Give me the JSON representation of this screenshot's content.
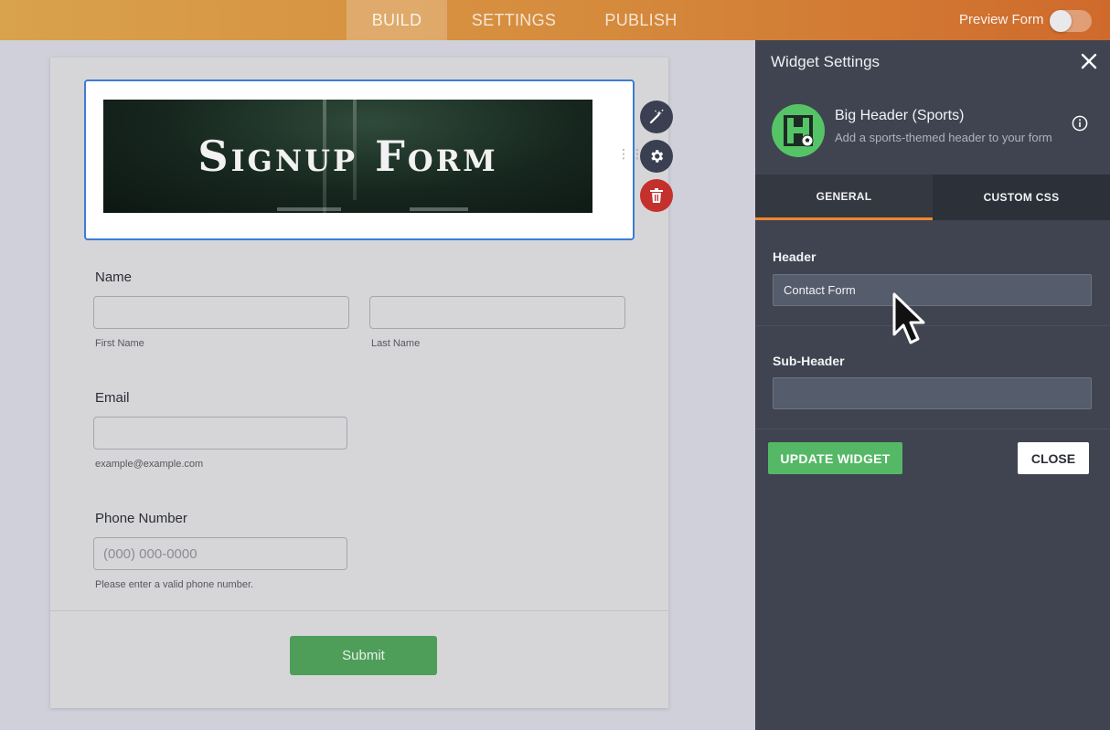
{
  "topbar": {
    "tabs": [
      "BUILD",
      "SETTINGS",
      "PUBLISH"
    ],
    "active_tab": "BUILD",
    "preview_label": "Preview Form",
    "preview_enabled": false
  },
  "form": {
    "header_banner_text": "Signup Form",
    "fields": {
      "name": {
        "label": "Name",
        "first_sublabel": "First Name",
        "last_sublabel": "Last Name"
      },
      "email": {
        "label": "Email",
        "sublabel": "example@example.com"
      },
      "phone": {
        "label": "Phone Number",
        "placeholder": "(000) 000-0000",
        "sublabel": "Please enter a valid phone number."
      }
    },
    "submit_label": "Submit"
  },
  "panel": {
    "title": "Widget Settings",
    "widget_name": "Big Header (Sports)",
    "widget_desc": "Add a sports-themed header to your form",
    "tabs": [
      "GENERAL",
      "CUSTOM CSS"
    ],
    "active_tab": "GENERAL",
    "header_label": "Header",
    "header_value": "Contact Form",
    "subheader_label": "Sub-Header",
    "subheader_value": "",
    "update_label": "UPDATE WIDGET",
    "close_label": "CLOSE"
  },
  "colors": {
    "accent_orange": "#f1852e",
    "update_green": "#55b866",
    "submit_green": "#4e9e59",
    "delete_red": "#c4302c",
    "selection_blue": "#3d7bd6"
  },
  "icons": [
    "magic-wand-icon",
    "gear-icon",
    "trash-icon",
    "close-icon",
    "info-icon",
    "drag-handle-icon",
    "soccer-ball-icon",
    "cursor-pointer-icon"
  ]
}
